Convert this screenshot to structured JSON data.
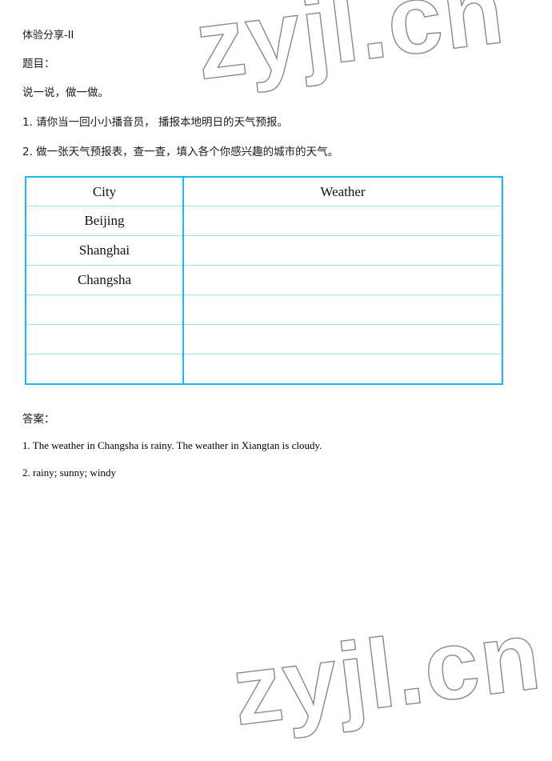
{
  "document": {
    "heading": "体验分享-II",
    "subheading": "题目：",
    "prompt": "说一说，做一做。",
    "tasks": [
      "1. 请你当一回小小播音员， 播报本地明日的天气预报。",
      "2. 做一张天气预报表，查一查，填入各个你感兴趣的城市的天气。"
    ],
    "answers_label": "答案：",
    "answers": [
      "1. The weather in Changsha is rainy. The weather in Xiangtan is cloudy.",
      "2. rainy; sunny; windy"
    ]
  },
  "table": {
    "headers": [
      "City",
      "Weather"
    ],
    "rows": [
      {
        "city": "Beijing",
        "weather": ""
      },
      {
        "city": "Shanghai",
        "weather": ""
      },
      {
        "city": "Changsha",
        "weather": ""
      },
      {
        "city": "",
        "weather": ""
      },
      {
        "city": "",
        "weather": ""
      },
      {
        "city": "",
        "weather": ""
      }
    ],
    "border_color": "#1eb6f0",
    "inner_border_color": "#9fdffa"
  },
  "watermark": {
    "text": "zyjl.cn",
    "color": "#8a8a8a"
  }
}
